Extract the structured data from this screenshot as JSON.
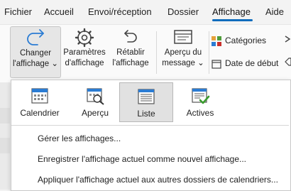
{
  "menu": {
    "tabs": [
      "Fichier",
      "Accueil",
      "Envoi/réception",
      "Dossier",
      "Affichage",
      "Aide"
    ],
    "active_tab": "Affichage"
  },
  "ribbon": {
    "change_view": {
      "line1": "Changer",
      "line2": "l'affichage",
      "chevron": "⌄"
    },
    "view_settings": {
      "line1": "Paramètres",
      "line2": "d'affichage"
    },
    "reset_view": {
      "line1": "Rétablir",
      "line2": "l'affichage"
    },
    "message_preview": {
      "line1": "Aperçu du",
      "line2": "message",
      "chevron": "⌄"
    },
    "categories_label": "Catégories",
    "start_date_label": "Date de début"
  },
  "dropdown": {
    "views": [
      {
        "label": "Calendrier",
        "icon": "calendar-icon",
        "selected": false
      },
      {
        "label": "Aperçu",
        "icon": "preview-icon",
        "selected": false
      },
      {
        "label": "Liste",
        "icon": "list-icon",
        "selected": true
      },
      {
        "label": "Actives",
        "icon": "active-icon",
        "selected": false
      }
    ],
    "commands": [
      "Gérer les affichages...",
      "Enregistrer l'affichage actuel comme nouvel affichage...",
      "Appliquer l'affichage actuel aux autres dossiers de calendriers..."
    ]
  },
  "colors": {
    "accent": "#0f6cbd",
    "dropdown_bg": "#ffffff",
    "selected_bg": "#e1e1e1",
    "check_green": "#3a9c2e"
  }
}
